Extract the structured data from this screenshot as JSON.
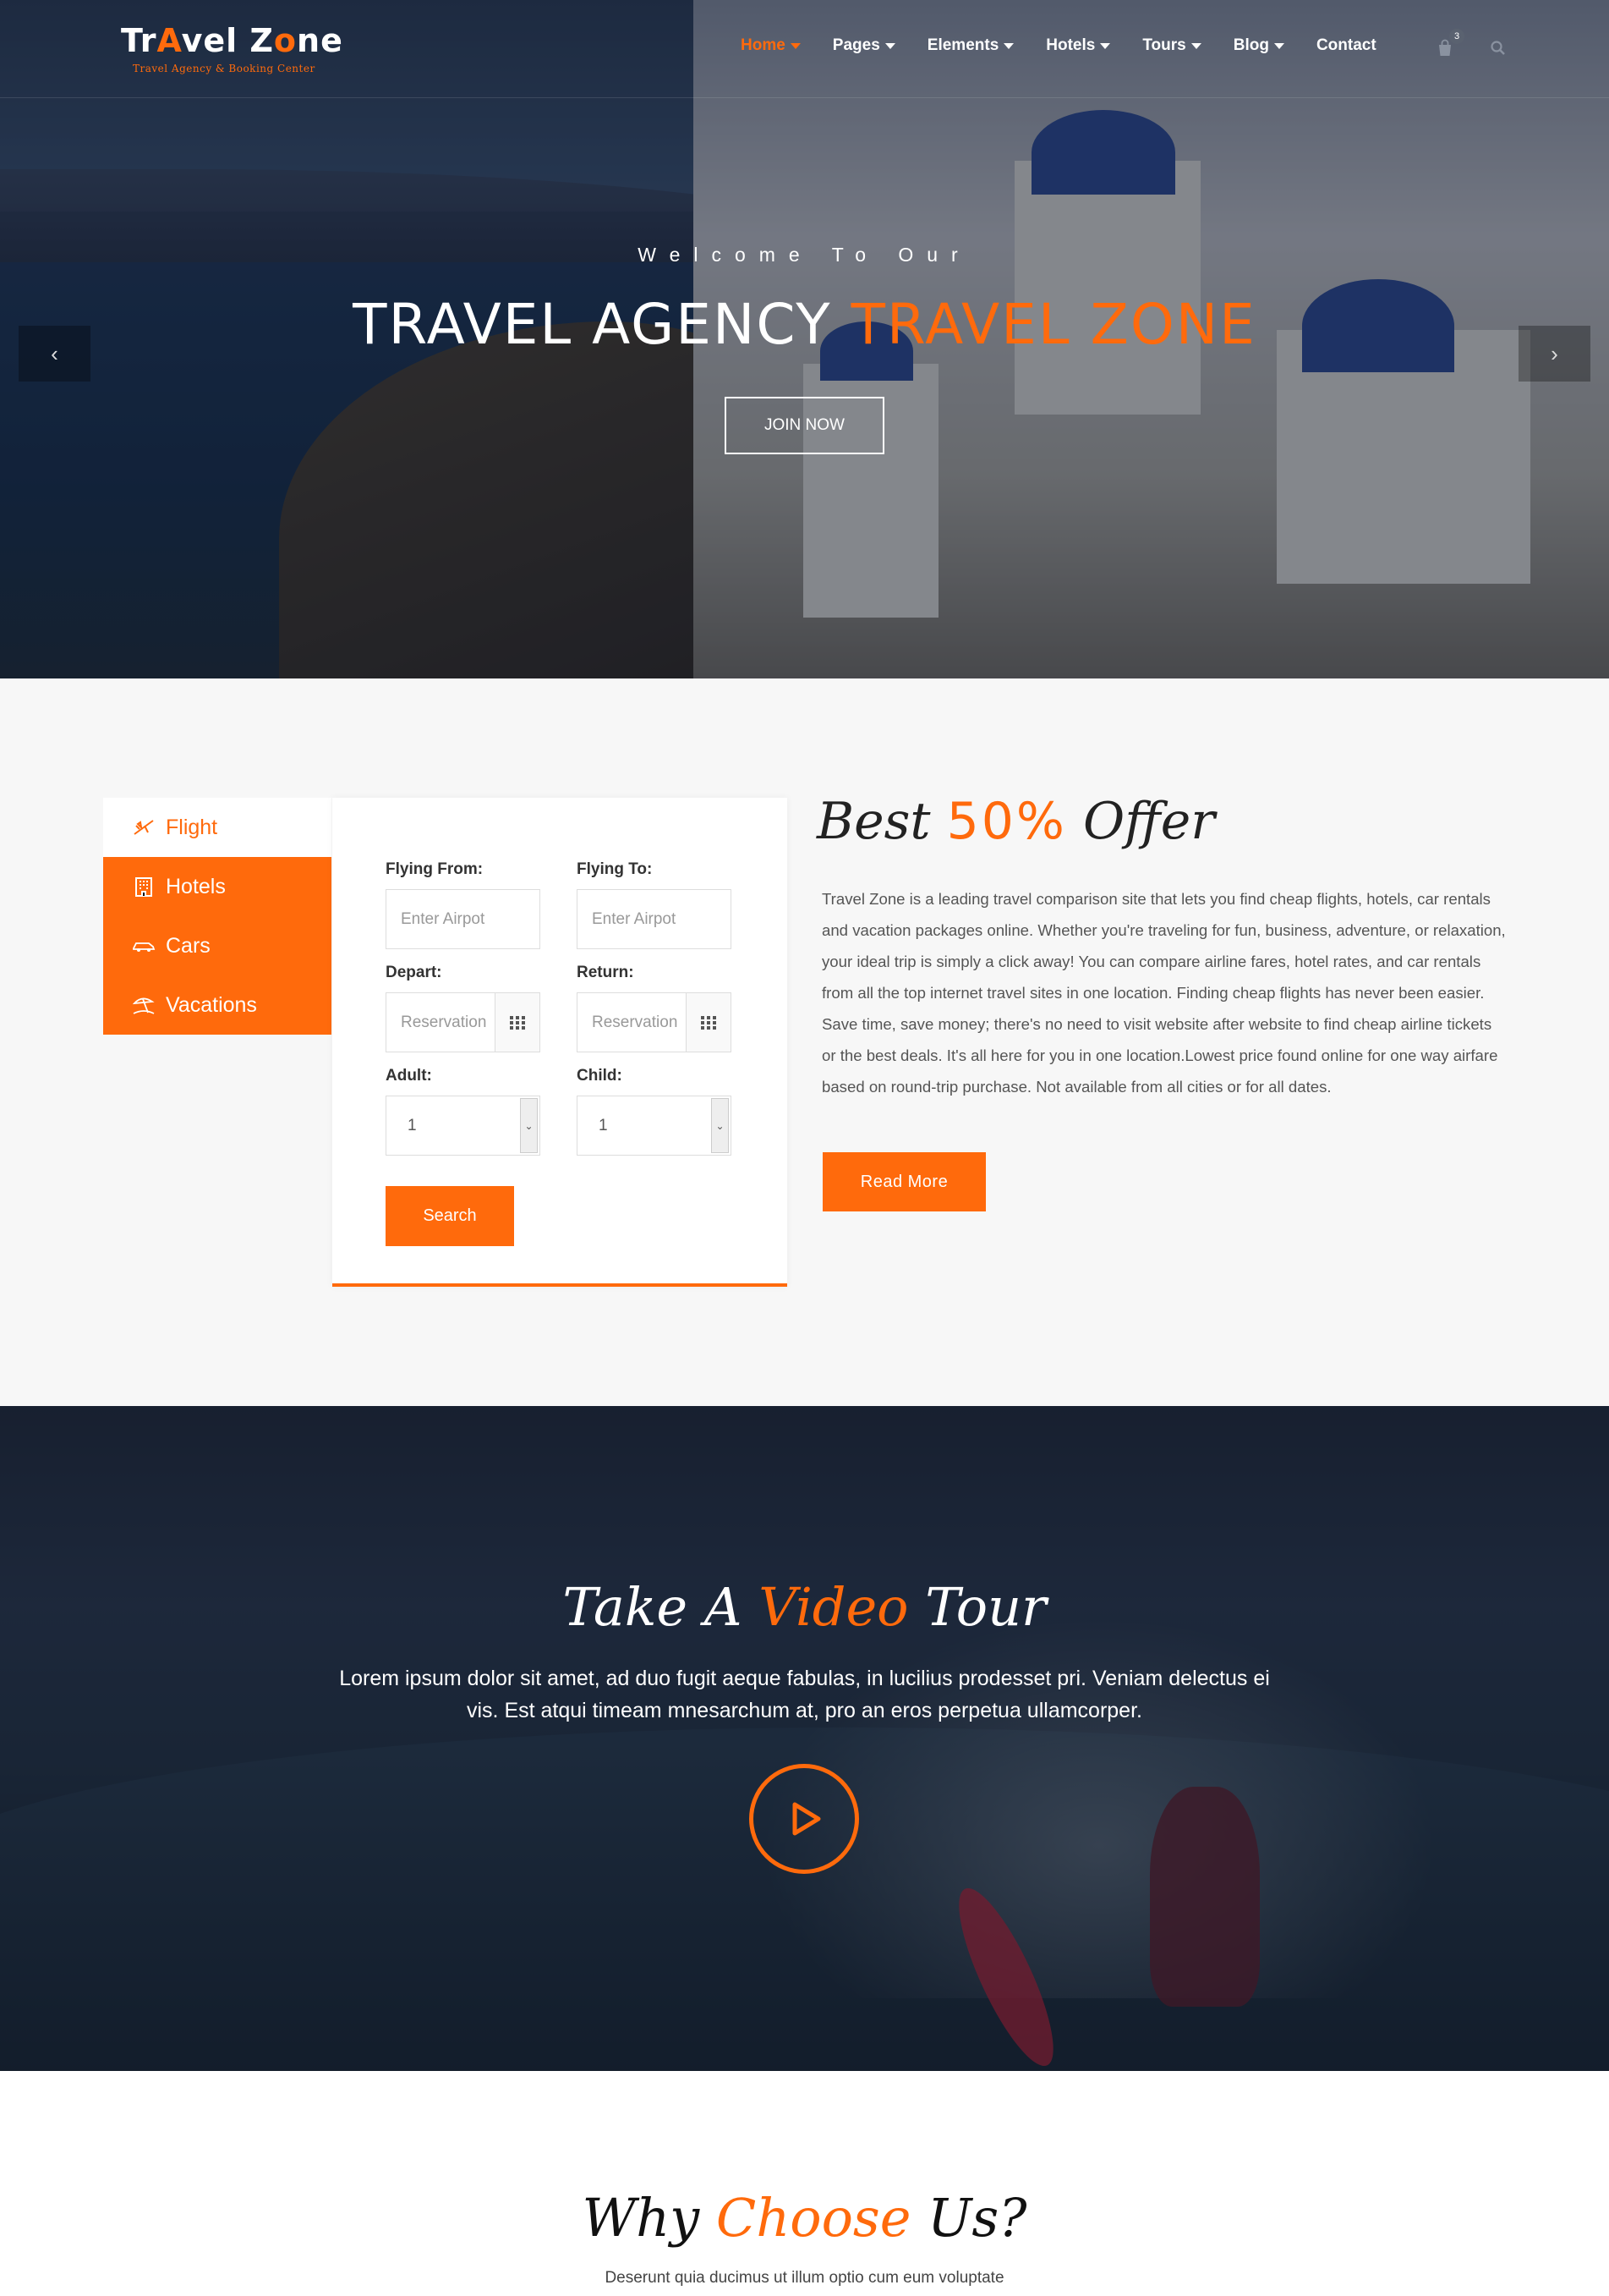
{
  "brand": {
    "logo_text_before": "Tr",
    "logo_text_mid": "vel Z",
    "logo_text_o": "o",
    "logo_text_after": "ne",
    "tagline": "Travel Agency & Booking Center",
    "accent_color": "#ff6a0c"
  },
  "nav": {
    "items": [
      {
        "label": "Home",
        "active": true
      },
      {
        "label": "Pages"
      },
      {
        "label": "Elements"
      },
      {
        "label": "Hotels"
      },
      {
        "label": "Tours"
      },
      {
        "label": "Blog"
      },
      {
        "label": "Contact"
      }
    ],
    "cart_count": "3",
    "cart_icon": "shopping-bag-icon",
    "search_icon": "search-icon"
  },
  "hero": {
    "subtitle": "Welcome To Our",
    "title_main": "TRAVEL AGENCY ",
    "title_highlight": "TRAVEL ZONE",
    "button": "JOIN NOW",
    "prev_arrow": "‹",
    "next_arrow": "›"
  },
  "booking": {
    "tabs": [
      {
        "label": "Flight",
        "icon": "plane-icon",
        "active": true
      },
      {
        "label": "Hotels",
        "icon": "hotel-icon"
      },
      {
        "label": "Cars",
        "icon": "car-icon"
      },
      {
        "label": "Vacations",
        "icon": "beach-umbrella-icon"
      }
    ],
    "flying_from_label": "Flying From:",
    "flying_from_placeholder": "Enter Airpot",
    "flying_to_label": "Flying To:",
    "flying_to_placeholder": "Enter Airpot",
    "depart_label": "Depart:",
    "depart_placeholder": "Reservation",
    "return_label": "Return:",
    "return_placeholder": "Reservation",
    "adult_label": "Adult:",
    "adult_value": "1",
    "child_label": "Child:",
    "child_value": "1",
    "search_button": "Search"
  },
  "offer": {
    "title_before": "Best ",
    "title_highlight": "50%",
    "title_after": " Offer",
    "text": "Travel Zone is a leading travel comparison site that lets you find cheap flights, hotels, car rentals and vacation packages online. Whether you're traveling for fun, business, adventure, or relaxation, your ideal trip is simply a click away! You can compare airline fares, hotel rates, and car rentals from all the top internet travel sites in one location. Finding cheap flights has never been easier. Save time, save money; there's no need to visit website after website to find cheap airline tickets or the best deals. It's all here for you in one location.Lowest price found online for one way airfare based on round-trip purchase. Not available from all cities or for all dates.",
    "button": "Read More"
  },
  "video": {
    "title_before": "Take A ",
    "title_highlight": "Video",
    "title_after": " Tour",
    "text": "Lorem ipsum dolor sit amet, ad duo fugit aeque fabulas, in lucilius prodesset pri. Veniam delectus ei vis. Est atqui timeam mnesarchum at, pro an eros perpetua ullamcorper.",
    "play_icon": "play-icon"
  },
  "why": {
    "title_before": "Why ",
    "title_highlight": "Choose",
    "title_after": " Us?",
    "subtitle": "Deserunt quia ducimus ut illum optio cum eum voluptate"
  }
}
